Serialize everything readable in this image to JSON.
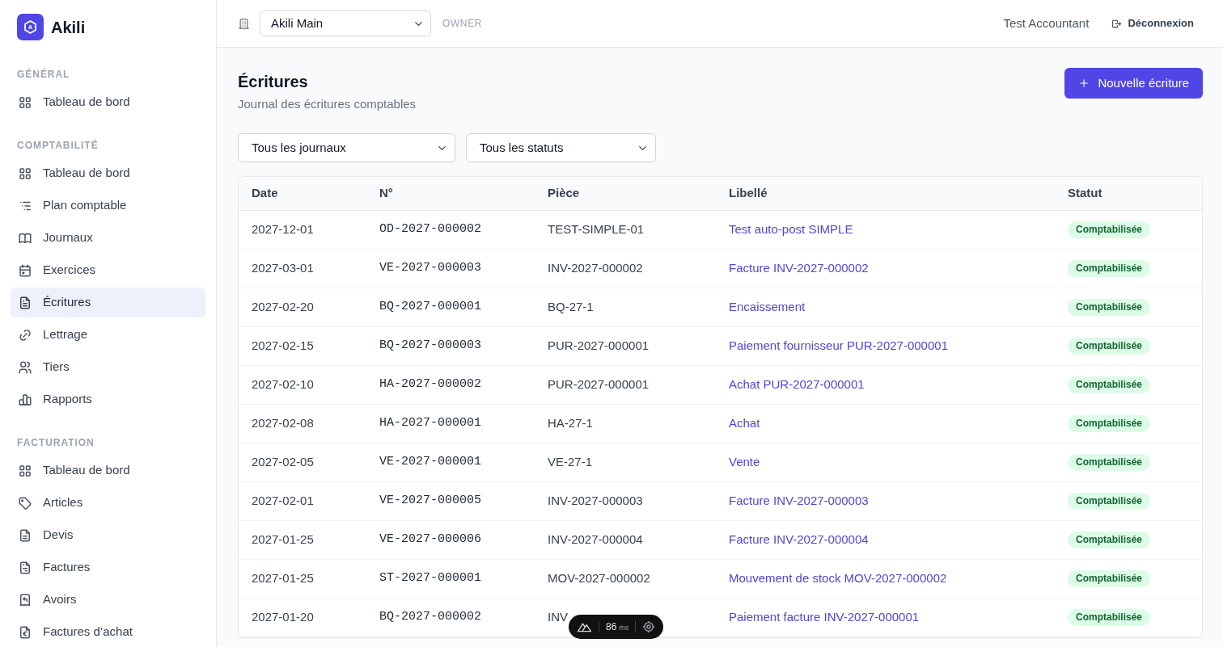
{
  "app": {
    "logo_mark": "A",
    "name": "Akili"
  },
  "sidebar": {
    "sections": [
      {
        "heading": "GÉNÉRAL",
        "items": [
          {
            "label": "Tableau de bord",
            "selected": false
          }
        ]
      },
      {
        "heading": "COMPTABILITÉ",
        "items": [
          {
            "label": "Tableau de bord",
            "selected": false
          },
          {
            "label": "Plan comptable",
            "selected": false
          },
          {
            "label": "Journaux",
            "selected": false
          },
          {
            "label": "Exercices",
            "selected": false
          },
          {
            "label": "Écritures",
            "selected": true
          },
          {
            "label": "Lettrage",
            "selected": false
          },
          {
            "label": "Tiers",
            "selected": false
          },
          {
            "label": "Rapports",
            "selected": false
          }
        ]
      },
      {
        "heading": "FACTURATION",
        "items": [
          {
            "label": "Tableau de bord",
            "selected": false
          },
          {
            "label": "Articles",
            "selected": false
          },
          {
            "label": "Devis",
            "selected": false
          },
          {
            "label": "Factures",
            "selected": false
          },
          {
            "label": "Avoirs",
            "selected": false
          },
          {
            "label": "Factures d’achat",
            "selected": false
          }
        ]
      }
    ]
  },
  "top_bar": {
    "organization_select": {
      "value": "Akili Main"
    },
    "role": "OWNER",
    "user_name": "Test Accountant",
    "logout_button": "Déconnexion"
  },
  "page": {
    "title": "Écritures",
    "subtitle": "Journal des écritures comptables",
    "new_button": "Nouvelle écriture",
    "filters": [
      {
        "value": "Tous les journaux"
      },
      {
        "value": "Tous les statuts"
      }
    ]
  },
  "table": {
    "columns": [
      "Date",
      "N°",
      "Pièce",
      "Libellé",
      "Statut"
    ],
    "rows": [
      {
        "date": "2027-12-01",
        "number": "OD-2027-000002",
        "piece": "TEST-SIMPLE-01",
        "label": "Test auto-post SIMPLE",
        "status": "Comptabilisée"
      },
      {
        "date": "2027-03-01",
        "number": "VE-2027-000003",
        "piece": "INV-2027-000002",
        "label": "Facture INV-2027-000002",
        "status": "Comptabilisée"
      },
      {
        "date": "2027-02-20",
        "number": "BQ-2027-000001",
        "piece": "BQ-27-1",
        "label": "Encaissement",
        "status": "Comptabilisée"
      },
      {
        "date": "2027-02-15",
        "number": "BQ-2027-000003",
        "piece": "PUR-2027-000001",
        "label": "Paiement fournisseur PUR-2027-000001",
        "status": "Comptabilisée"
      },
      {
        "date": "2027-02-10",
        "number": "HA-2027-000002",
        "piece": "PUR-2027-000001",
        "label": "Achat PUR-2027-000001",
        "status": "Comptabilisée"
      },
      {
        "date": "2027-02-08",
        "number": "HA-2027-000001",
        "piece": "HA-27-1",
        "label": "Achat",
        "status": "Comptabilisée"
      },
      {
        "date": "2027-02-05",
        "number": "VE-2027-000001",
        "piece": "VE-27-1",
        "label": "Vente",
        "status": "Comptabilisée"
      },
      {
        "date": "2027-02-01",
        "number": "VE-2027-000005",
        "piece": "INV-2027-000003",
        "label": "Facture INV-2027-000003",
        "status": "Comptabilisée"
      },
      {
        "date": "2027-01-25",
        "number": "VE-2027-000006",
        "piece": "INV-2027-000004",
        "label": "Facture INV-2027-000004",
        "status": "Comptabilisée"
      },
      {
        "date": "2027-01-25",
        "number": "ST-2027-000001",
        "piece": "MOV-2027-000002",
        "label": "Mouvement de stock MOV-2027-000002",
        "status": "Comptabilisée"
      },
      {
        "date": "2027-01-20",
        "number": "BQ-2027-000002",
        "piece": "INV",
        "label": "Paiement facture INV-2027-000001",
        "status": "Comptabilisée"
      }
    ]
  },
  "devtools_bar": {
    "value": "86",
    "unit": "ms"
  }
}
